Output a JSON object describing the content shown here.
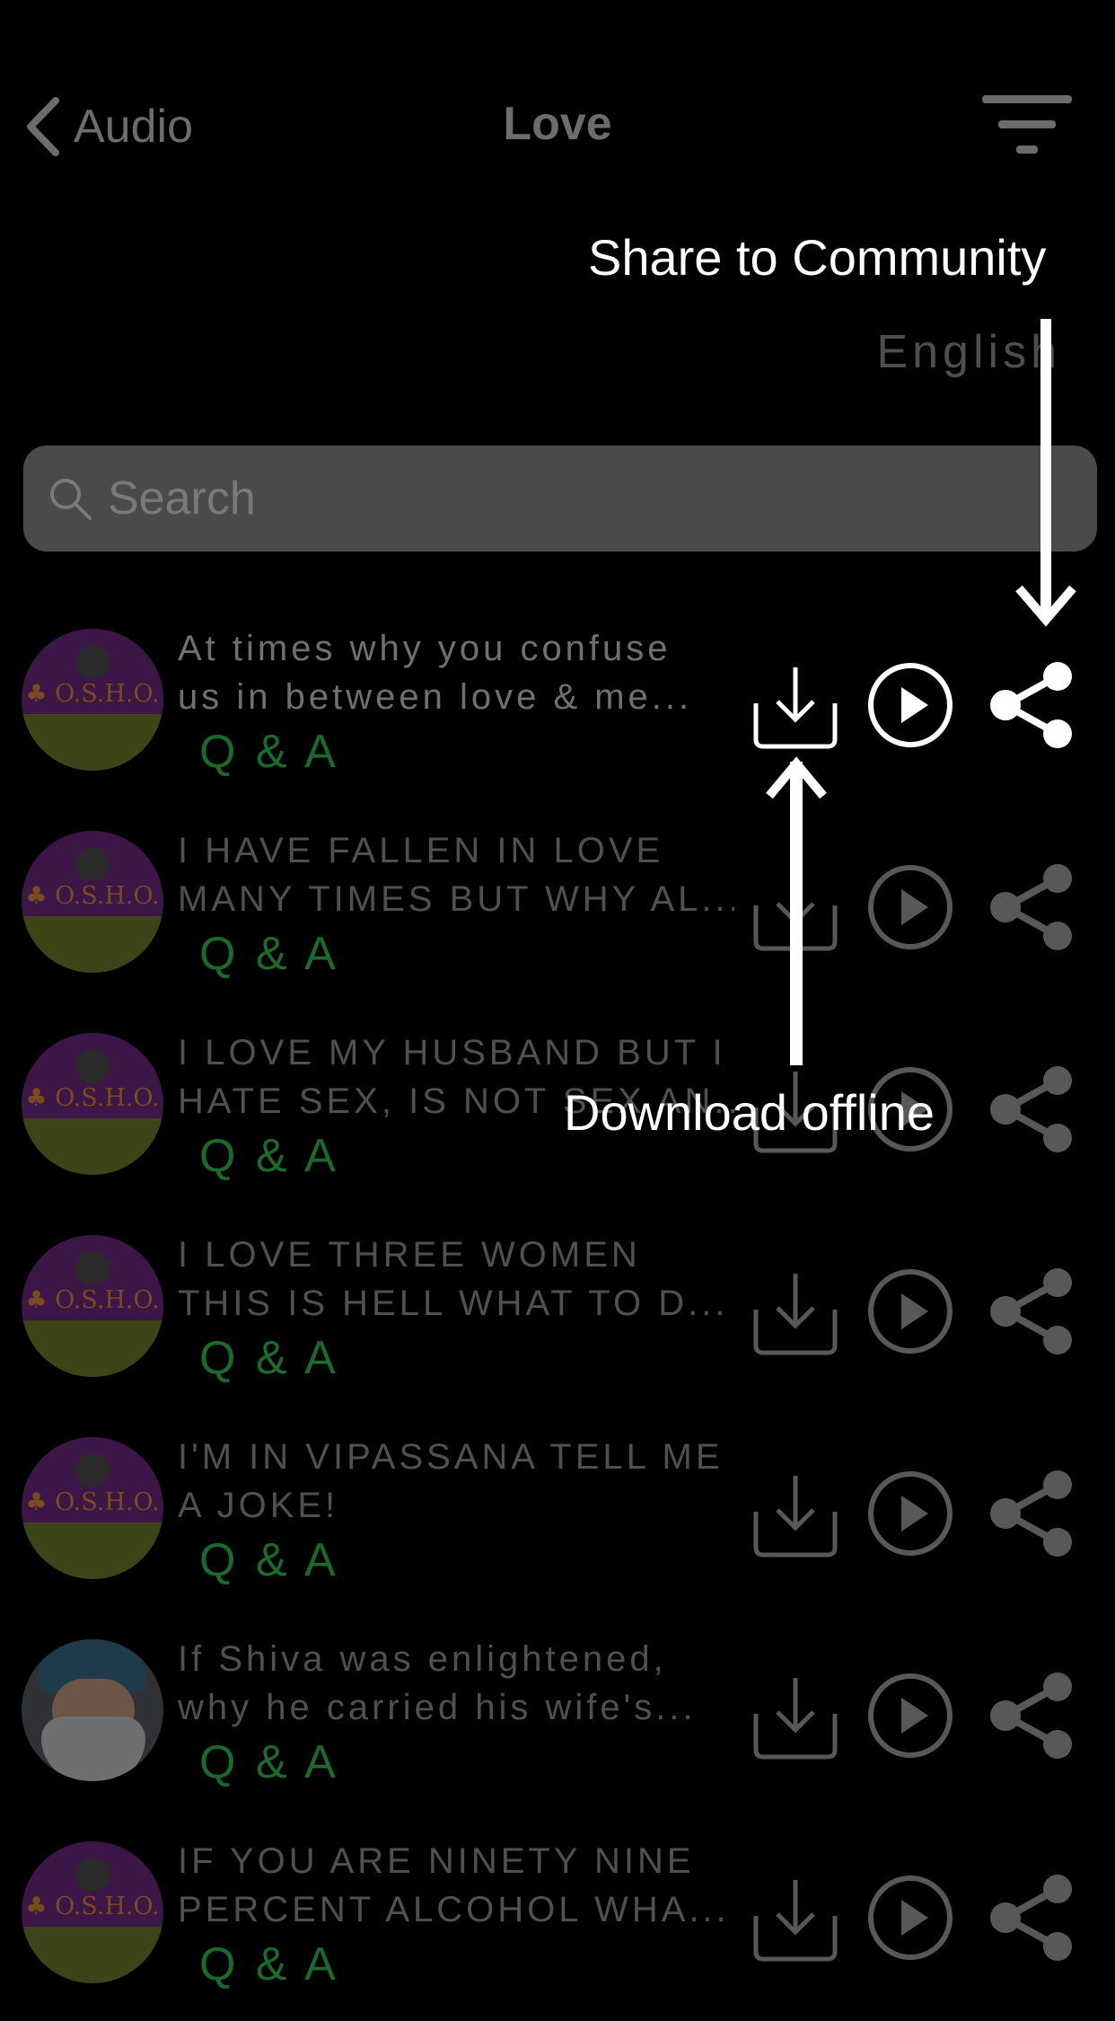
{
  "nav": {
    "back_label": "Audio",
    "title": "Love",
    "filter_icon": "filter-icon"
  },
  "language": "English",
  "search": {
    "placeholder": "Search"
  },
  "items": [
    {
      "line1": "At times why you confuse",
      "line2": "us in between love & me...",
      "tag": "Q & A",
      "avatar": "logo"
    },
    {
      "line1": "I HAVE FALLEN IN LOVE",
      "line2": "MANY TIMES BUT WHY AL...",
      "tag": "Q & A",
      "avatar": "logo"
    },
    {
      "line1": "I LOVE MY HUSBAND BUT I",
      "line2": "HATE SEX, IS NOT SEX AN...",
      "tag": "Q & A",
      "avatar": "logo"
    },
    {
      "line1": "I LOVE THREE WOMEN",
      "line2": "THIS IS HELL WHAT TO D...",
      "tag": "Q & A",
      "avatar": "logo"
    },
    {
      "line1": "I'M IN VIPASSANA TELL ME",
      "line2": "A JOKE!",
      "tag": "Q & A",
      "avatar": "logo"
    },
    {
      "line1": "If Shiva was enlightened,",
      "line2": "why he carried his wife's...",
      "tag": "Q & A",
      "avatar": "face"
    },
    {
      "line1": "IF YOU ARE NINETY NINE",
      "line2": "PERCENT ALCOHOL WHA...",
      "tag": "Q & A",
      "avatar": "logo"
    }
  ],
  "annotations": {
    "share": "Share to Community",
    "download": "Download offline"
  },
  "colors": {
    "tag": "#1b6a2c",
    "highlight": "#ffffff",
    "dim": "#585858"
  }
}
